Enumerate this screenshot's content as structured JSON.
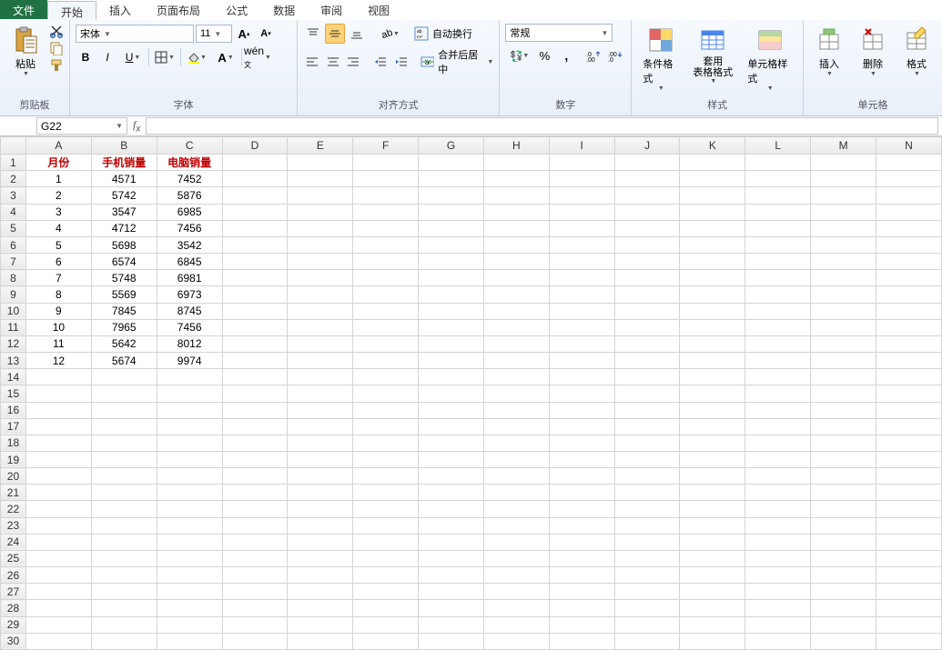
{
  "tabs": {
    "file": "文件",
    "items": [
      "开始",
      "插入",
      "页面布局",
      "公式",
      "数据",
      "审阅",
      "视图"
    ],
    "active_index": 0
  },
  "ribbon": {
    "clipboard": {
      "label": "剪贴板",
      "paste": "粘贴"
    },
    "font": {
      "label": "字体",
      "family": "宋体",
      "size": "11"
    },
    "alignment": {
      "label": "对齐方式",
      "wrap": "自动换行",
      "merge": "合并后居中"
    },
    "number": {
      "label": "数字",
      "format": "常规"
    },
    "styles": {
      "label": "样式",
      "cond": "条件格式",
      "table": "套用\n表格格式",
      "cell": "单元格样式"
    },
    "cells": {
      "label": "单元格",
      "insert": "插入",
      "delete": "删除",
      "format": "格式"
    }
  },
  "name_box": "G22",
  "formula": "",
  "columns": [
    "A",
    "B",
    "C",
    "D",
    "E",
    "F",
    "G",
    "H",
    "I",
    "J",
    "K",
    "L",
    "M",
    "N"
  ],
  "row_count": 30,
  "sheet": {
    "headers": [
      "月份",
      "手机销量",
      "电脑销量"
    ],
    "rows": [
      [
        "1",
        "4571",
        "7452"
      ],
      [
        "2",
        "5742",
        "5876"
      ],
      [
        "3",
        "3547",
        "6985"
      ],
      [
        "4",
        "4712",
        "7456"
      ],
      [
        "5",
        "5698",
        "3542"
      ],
      [
        "6",
        "6574",
        "6845"
      ],
      [
        "7",
        "5748",
        "6981"
      ],
      [
        "8",
        "5569",
        "6973"
      ],
      [
        "9",
        "7845",
        "8745"
      ],
      [
        "10",
        "7965",
        "7456"
      ],
      [
        "11",
        "5642",
        "8012"
      ],
      [
        "12",
        "5674",
        "9974"
      ]
    ]
  },
  "chart_data": {
    "type": "table",
    "title": "",
    "columns": [
      "月份",
      "手机销量",
      "电脑销量"
    ],
    "rows": [
      [
        1,
        4571,
        7452
      ],
      [
        2,
        5742,
        5876
      ],
      [
        3,
        3547,
        6985
      ],
      [
        4,
        4712,
        7456
      ],
      [
        5,
        5698,
        3542
      ],
      [
        6,
        6574,
        6845
      ],
      [
        7,
        5748,
        6981
      ],
      [
        8,
        5569,
        6973
      ],
      [
        9,
        7845,
        8745
      ],
      [
        10,
        7965,
        7456
      ],
      [
        11,
        5642,
        8012
      ],
      [
        12,
        5674,
        9974
      ]
    ]
  }
}
